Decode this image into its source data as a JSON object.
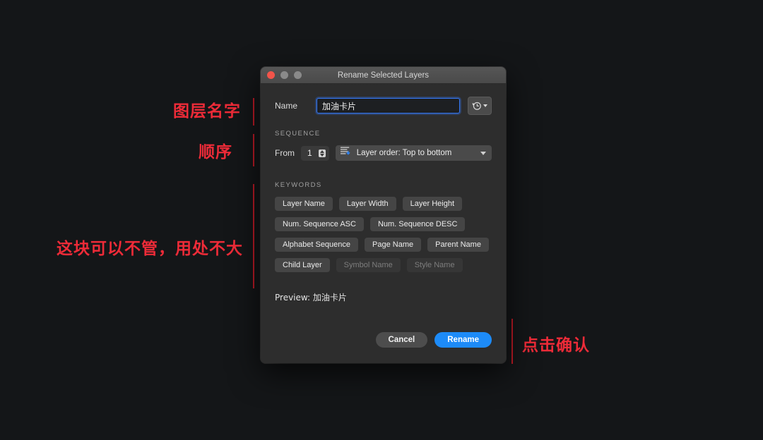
{
  "annotations": [
    {
      "id": "layer-name",
      "text": "图层名字"
    },
    {
      "id": "order",
      "text": "顺序"
    },
    {
      "id": "ignore",
      "text": "这块可以不管，用处不大"
    },
    {
      "id": "confirm",
      "text": "点击确认"
    }
  ],
  "colors": {
    "annotation_red": "#ee2b38",
    "annotation_bar": "#c01a26",
    "accent_blue": "#1d8bf8",
    "focus_ring": "#3478f6",
    "page_background": "#141618",
    "dialog_background": "#2d2d2d",
    "titlebar": "#4a4a4a"
  },
  "dialog": {
    "title": "Rename Selected Layers",
    "traffic_lights": [
      "close",
      "minimize",
      "zoom"
    ],
    "name": {
      "label": "Name",
      "value": "加油卡片",
      "placeholder": "",
      "history_icon": "history-clock-icon"
    },
    "sequence": {
      "section_label": "SEQUENCE",
      "from_label": "From",
      "from_value": "1",
      "order_icon": "layer-order-icon",
      "order_value": "Layer order: Top to bottom"
    },
    "keywords": {
      "section_label": "KEYWORDS",
      "rows": [
        [
          {
            "label": "Layer Name",
            "disabled": false
          },
          {
            "label": "Layer Width",
            "disabled": false
          },
          {
            "label": "Layer Height",
            "disabled": false
          }
        ],
        [
          {
            "label": "Num. Sequence ASC",
            "disabled": false
          },
          {
            "label": "Num. Sequence DESC",
            "disabled": false
          }
        ],
        [
          {
            "label": "Alphabet Sequence",
            "disabled": false
          },
          {
            "label": "Page Name",
            "disabled": false
          },
          {
            "label": "Parent Name",
            "disabled": false
          }
        ],
        [
          {
            "label": "Child Layer",
            "disabled": false
          },
          {
            "label": "Symbol Name",
            "disabled": true
          },
          {
            "label": "Style Name",
            "disabled": true
          }
        ]
      ]
    },
    "preview": {
      "label": "Preview:",
      "value": "加油卡片",
      "text": "Preview: 加油卡片"
    },
    "footer": {
      "cancel_label": "Cancel",
      "rename_label": "Rename"
    }
  }
}
